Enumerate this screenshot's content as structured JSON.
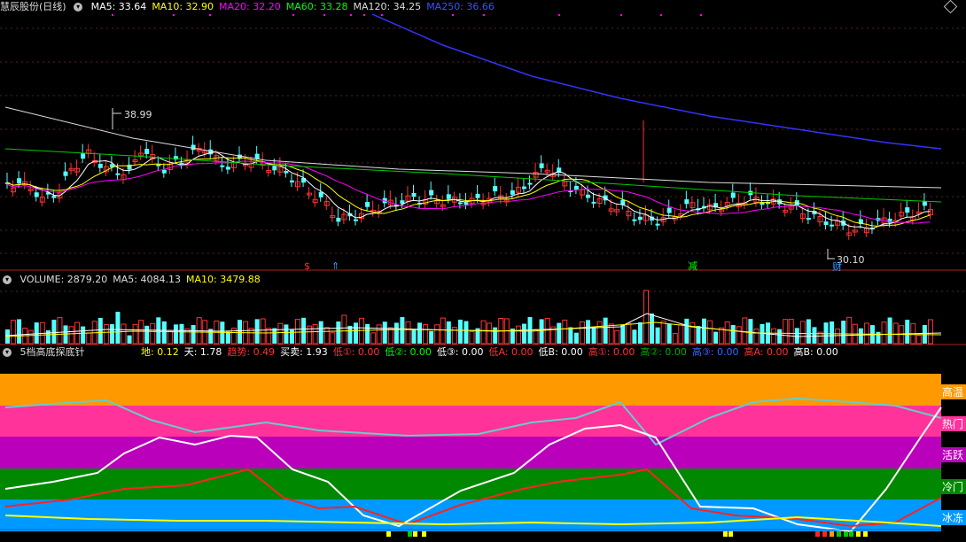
{
  "title_bar": {
    "stock": "慧辰股份(日线)",
    "ma": [
      {
        "t": "MA5: 33.64",
        "c": "#ffffff"
      },
      {
        "t": "MA10: 32.90",
        "c": "#ffff00"
      },
      {
        "t": "MA20: 32.20",
        "c": "#ff00ff"
      },
      {
        "t": "MA60: 33.28",
        "c": "#00ff00"
      },
      {
        "t": "MA120: 34.25",
        "c": "#dddddd"
      },
      {
        "t": "MA250: 36.66",
        "c": "#3355ff"
      }
    ]
  },
  "price_panel": {
    "high_label": "38.99",
    "low_label": "30.10",
    "markers": {
      "s": "$",
      "up": "⇑",
      "jian": "减",
      "cai": "财"
    }
  },
  "volume_bar": {
    "items": [
      {
        "t": "VOLUME: 2879.20",
        "c": "#dddddd"
      },
      {
        "t": "MA5: 4084.13",
        "c": "#dddddd"
      },
      {
        "t": "MA10: 3479.88",
        "c": "#ffff00"
      }
    ]
  },
  "indicator_bar": {
    "name": "5档高底探底针",
    "items": [
      {
        "t": "地: 0.12",
        "c": "#ffff00"
      },
      {
        "t": "天: 1.78",
        "c": "#ffffff"
      },
      {
        "t": "趋势: 0.49",
        "c": "#ff3333"
      },
      {
        "t": "买卖: 1.93",
        "c": "#ffffff"
      },
      {
        "t": "低①: 0.00",
        "c": "#ff3333"
      },
      {
        "t": "低②: 0.00",
        "c": "#00ff00"
      },
      {
        "t": "低③: 0.00",
        "c": "#ffffff"
      },
      {
        "t": "低A: 0.00",
        "c": "#ff3333"
      },
      {
        "t": "低B: 0.00",
        "c": "#ffffff"
      },
      {
        "t": "高①: 0.00",
        "c": "#ff3333"
      },
      {
        "t": "高②: 0.00",
        "c": "#00aa00"
      },
      {
        "t": "高③: 0.00",
        "c": "#3366ff"
      },
      {
        "t": "高A: 0.00",
        "c": "#ff3333"
      },
      {
        "t": "高B: 0.00",
        "c": "#ffffff"
      }
    ]
  },
  "zones": [
    {
      "label": "高温",
      "color": "#ff9900"
    },
    {
      "label": "热门",
      "color": "#ff3399"
    },
    {
      "label": "活跃",
      "color": "#bb00bb"
    },
    {
      "label": "冷门",
      "color": "#008800"
    },
    {
      "label": "冰冻",
      "color": "#0099ff"
    }
  ]
}
